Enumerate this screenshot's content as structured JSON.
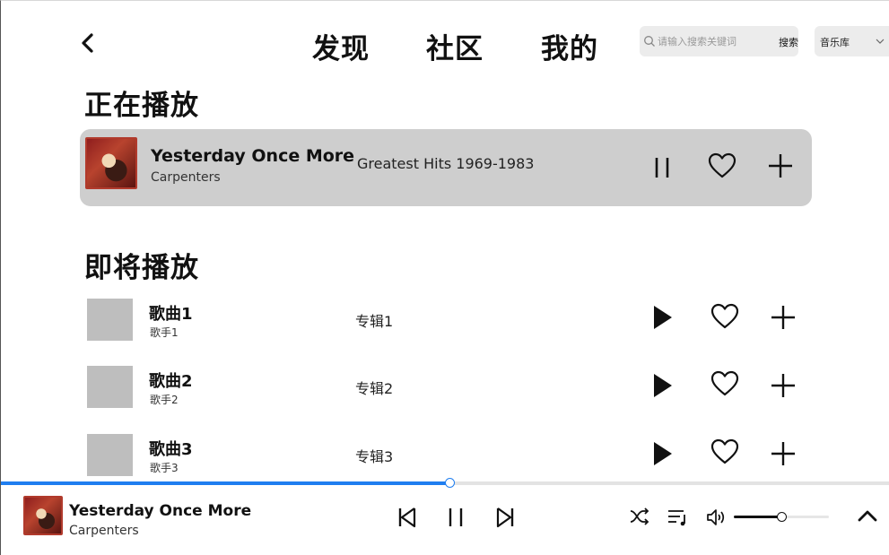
{
  "nav": {
    "tabs": [
      "发现",
      "社区",
      "我的"
    ],
    "search": {
      "placeholder": "请输入搜索关键词",
      "button": "搜索"
    },
    "source_select": {
      "value": "音乐库"
    }
  },
  "now_playing_section": {
    "heading": "正在播放",
    "track": {
      "title": "Yesterday Once More",
      "artist": "Carpenters",
      "album": "Greatest Hits 1969-1983",
      "state_icon": "pause-icon"
    }
  },
  "up_next_section": {
    "heading": "即将播放",
    "items": [
      {
        "title": "歌曲1",
        "artist": "歌手1",
        "album": "专辑1"
      },
      {
        "title": "歌曲2",
        "artist": "歌手2",
        "album": "专辑2"
      },
      {
        "title": "歌曲3",
        "artist": "歌手3",
        "album": "专辑3"
      }
    ]
  },
  "player": {
    "title": "Yesterday Once More",
    "artist": "Carpenters",
    "progress_fraction": 0.505,
    "volume_fraction": 0.5,
    "accent_color": "#1f7ef0",
    "icons": [
      "previous-icon",
      "pause-icon",
      "next-icon",
      "shuffle-icon",
      "playlist-icon",
      "volume-icon",
      "chevron-up-icon"
    ]
  }
}
